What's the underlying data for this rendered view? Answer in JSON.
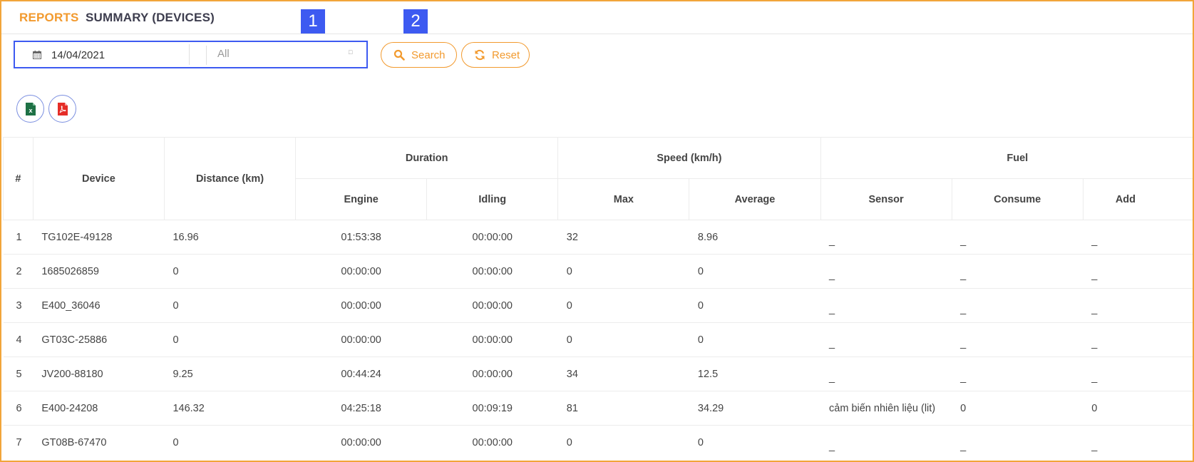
{
  "header": {
    "section": "REPORTS",
    "title": "SUMMARY (DEVICES)"
  },
  "markers": [
    "1",
    "2"
  ],
  "filters": {
    "date": "14/04/2021",
    "device_select": "All",
    "date_icon": "calendar-icon",
    "caret_icon": "caret-icon"
  },
  "buttons": {
    "search": "Search",
    "reset": "Reset",
    "export_excel_icon": "excel-icon",
    "export_pdf_icon": "pdf-icon"
  },
  "colors": {
    "accent": "#f29a2e",
    "highlight": "#3d5af1",
    "excel": "#1e7145",
    "pdf": "#e52d27"
  },
  "table": {
    "headers": {
      "num": "#",
      "device": "Device",
      "distance": "Distance (km)",
      "duration": "Duration",
      "engine": "Engine",
      "idling": "Idling",
      "speed": "Speed (km/h)",
      "max": "Max",
      "average": "Average",
      "fuel": "Fuel",
      "sensor": "Sensor",
      "consume": "Consume",
      "add": "Add"
    },
    "rows": [
      [
        "1",
        "TG102E-49128",
        "16.96",
        "01:53:38",
        "00:00:00",
        "32",
        "8.96",
        "_",
        "_",
        "_"
      ],
      [
        "2",
        "1685026859",
        "0",
        "00:00:00",
        "00:00:00",
        "0",
        "0",
        "_",
        "_",
        "_"
      ],
      [
        "3",
        "E400_36046",
        "0",
        "00:00:00",
        "00:00:00",
        "0",
        "0",
        "_",
        "_",
        "_"
      ],
      [
        "4",
        "GT03C-25886",
        "0",
        "00:00:00",
        "00:00:00",
        "0",
        "0",
        "_",
        "_",
        "_"
      ],
      [
        "5",
        "JV200-88180",
        "9.25",
        "00:44:24",
        "00:00:00",
        "34",
        "12.5",
        "_",
        "_",
        "_"
      ],
      [
        "6",
        "E400-24208",
        "146.32",
        "04:25:18",
        "00:09:19",
        "81",
        "34.29",
        "cảm biến nhiên liệu (lit)",
        "0",
        "0"
      ],
      [
        "7",
        "GT08B-67470",
        "0",
        "00:00:00",
        "00:00:00",
        "0",
        "0",
        "_",
        "_",
        "_"
      ]
    ]
  }
}
